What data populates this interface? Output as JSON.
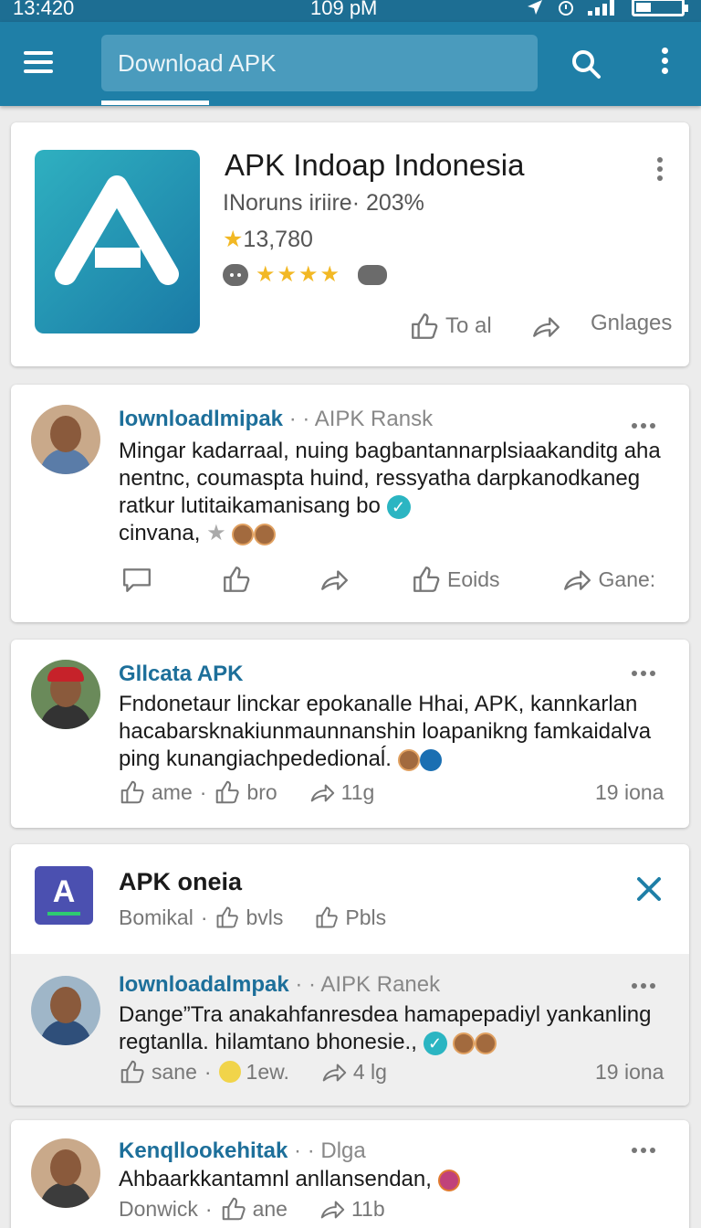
{
  "status_bar": {
    "time_left": "13:420",
    "time_center": "109 pM"
  },
  "appbar": {
    "search_text": "Download APK"
  },
  "app_card": {
    "name": "APK Indoap Indonesia",
    "subtitle": "INoruns iriire· 203%",
    "rating_count": "13,780",
    "stars": "★★★★",
    "actions": {
      "like_label": "To al",
      "share_label": "Gnlages"
    }
  },
  "posts": [
    {
      "author": "Iownloadlmipak",
      "meta": "· · AIPK  Ransk",
      "text": "Mingar kadarraal, nuing bagbantannarplsiaakanditg aha nentnc, coumaspta huind, ressyatha darpkanodkaneg ratkur lutitaikamanisang bo",
      "text_tail": "cinvana,",
      "actions": {
        "like2_label": "Eoids",
        "share2_label": "Gane:"
      }
    },
    {
      "author": "Gllcata APK",
      "text": "Fndonetaur linckar epokanalle Hhai, APK, kannkarlan hacabarsknakiunmaunnanshin loapanikng famkaidalva ping kunangiachpededionaĺ.",
      "actions": {
        "like_label": "ame",
        "like2_label": "bro",
        "share_label": "11g"
      },
      "time": "19 iona"
    },
    {
      "author": "Iownloadalmpak",
      "meta": "· · AIPK  Ranek",
      "text": "Dange”Tra anakahfanresdea hamapepadiyl yankanling regtanlla. hilamtano bhonesie.,",
      "actions": {
        "like_label": "sane",
        "like2_label": "1ew.",
        "share_label": "4 lg"
      },
      "time": "19 iona"
    },
    {
      "author": "Kenqllookehitak",
      "meta": "· · Dlga",
      "text": "Ahbaarkkantamnl anllansendan,",
      "actions": {
        "label": "Donwick",
        "like_label": "ane",
        "share_label": "11b"
      }
    }
  ],
  "promo_card": {
    "icon_letter": "A",
    "title": "APK oneia",
    "sub": "Bomikal",
    "like_label": "bvls",
    "like2_label": "Pbls"
  },
  "colors": {
    "appbar": "#1f7fa7",
    "status_bar": "#1d6e93",
    "link": "#1d6f9a",
    "star": "#f2b824",
    "check": "#2bb5c2"
  }
}
